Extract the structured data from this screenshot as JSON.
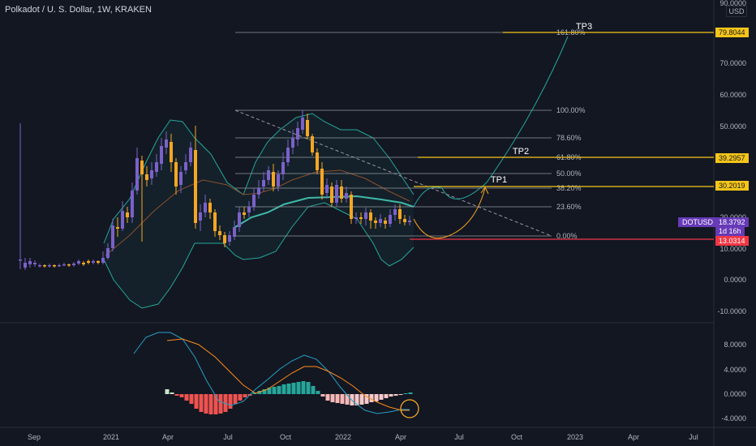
{
  "header": {
    "title": "Polkadot / U. S. Dollar, 1W, KRAKEN",
    "currency": "USD"
  },
  "y_axis_labels": [
    "90.0000",
    "70.0000",
    "60.0000",
    "50.0000",
    "20.0000",
    "10.0000",
    "0.0000",
    "-10.0000"
  ],
  "macd_axis_labels": [
    "8.0000",
    "4.0000",
    "0.0000",
    "-4.0000"
  ],
  "x_axis_labels": [
    "Sep",
    "2021",
    "Apr",
    "Jul",
    "Oct",
    "2022",
    "Apr",
    "Jul",
    "Oct",
    "2023",
    "Apr",
    "Jul"
  ],
  "fib_labels": [
    "161.80%",
    "100.00%",
    "78.60%",
    "61.80%",
    "50.00%",
    "38.20%",
    "23.60%",
    "0.00%"
  ],
  "targets": [
    {
      "label": "TP3",
      "price": "79.8044"
    },
    {
      "label": "TP2",
      "price": "39.2957"
    },
    {
      "label": "TP1",
      "price": "30.2019"
    }
  ],
  "price_tags": {
    "symbol": "DOTUSD",
    "last_price": "18.3792",
    "countdown": "1d 16h",
    "stop_price": "13.0314"
  },
  "colors": {
    "background": "#131722",
    "candle_up": "#7b61c9",
    "candle_down": "#f5a623",
    "target_line": "#f5c518",
    "stop_line": "#f23645",
    "symbol_tag": "#673ab7",
    "bollinger": "#26a69a",
    "moving_average": "#8a4f2e",
    "macd_line": "#26a0c8",
    "signal_line": "#ff8c1a"
  }
}
